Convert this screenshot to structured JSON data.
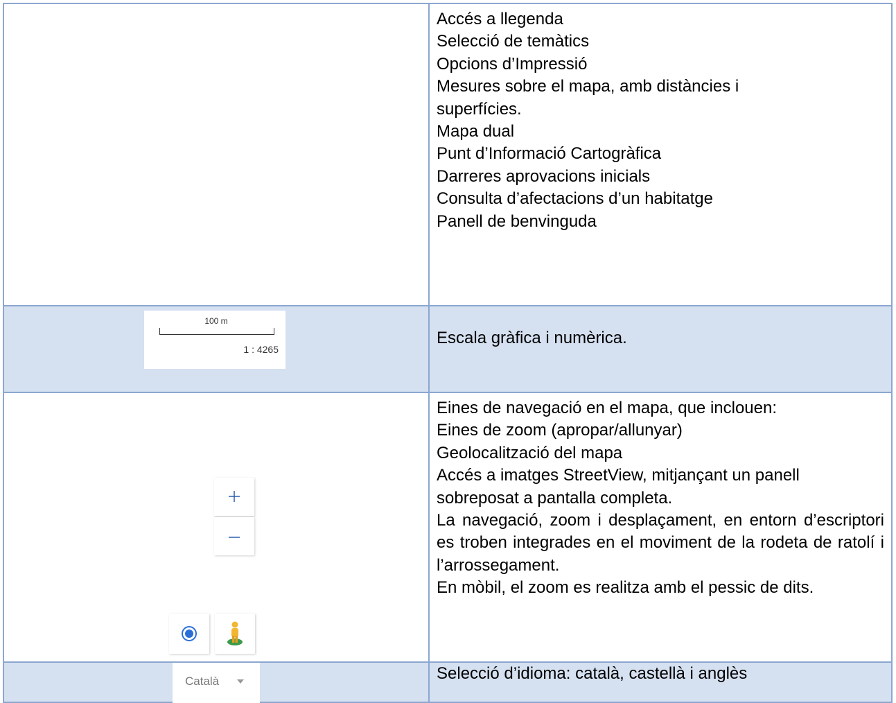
{
  "rows": [
    {
      "description": [
        "Accés a llegenda",
        "Selecció de temàtics",
        "Opcions d’Impressió",
        "Mesures sobre el mapa, amb distàncies i superfícies.",
        "Mapa dual",
        "Punt d’Informació Cartogràfica",
        "Darreres aprovacions inicials",
        "Consulta d’afectacions d’un habitatge",
        "Panell de benvinguda"
      ]
    },
    {
      "scale": {
        "label": "100 m",
        "ratio": "1 : 4265"
      },
      "description": "Escala gràfica i numèrica."
    },
    {
      "description": [
        "Eines de navegació en el mapa, que inclouen:",
        "Eines de zoom (apropar/allunyar)",
        "Geolocalització del mapa",
        "Accés a imatges StreetView, mitjançant un panell sobreposat  a pantalla completa.",
        "La navegació, zoom i desplaçament, en entorn d’escriptori es troben integrades en el moviment de la rodeta de ratolí i l’arrossegament.",
        "En mòbil, el zoom es realitza amb el pessic de dits."
      ],
      "icons": [
        "zoom-in-icon",
        "zoom-out-icon",
        "locate-icon",
        "streetview-pegman-icon"
      ]
    },
    {
      "language": {
        "selected": "Català"
      },
      "description": "Selecció d’idioma: català, castellà i anglès"
    }
  ],
  "colors": {
    "border": "#8ba7d0",
    "row_highlight": "#d5e0f0",
    "locate_blue": "#2b6fd6",
    "pegman_yellow": "#f2b632",
    "pegman_green": "#3d9a4a"
  }
}
